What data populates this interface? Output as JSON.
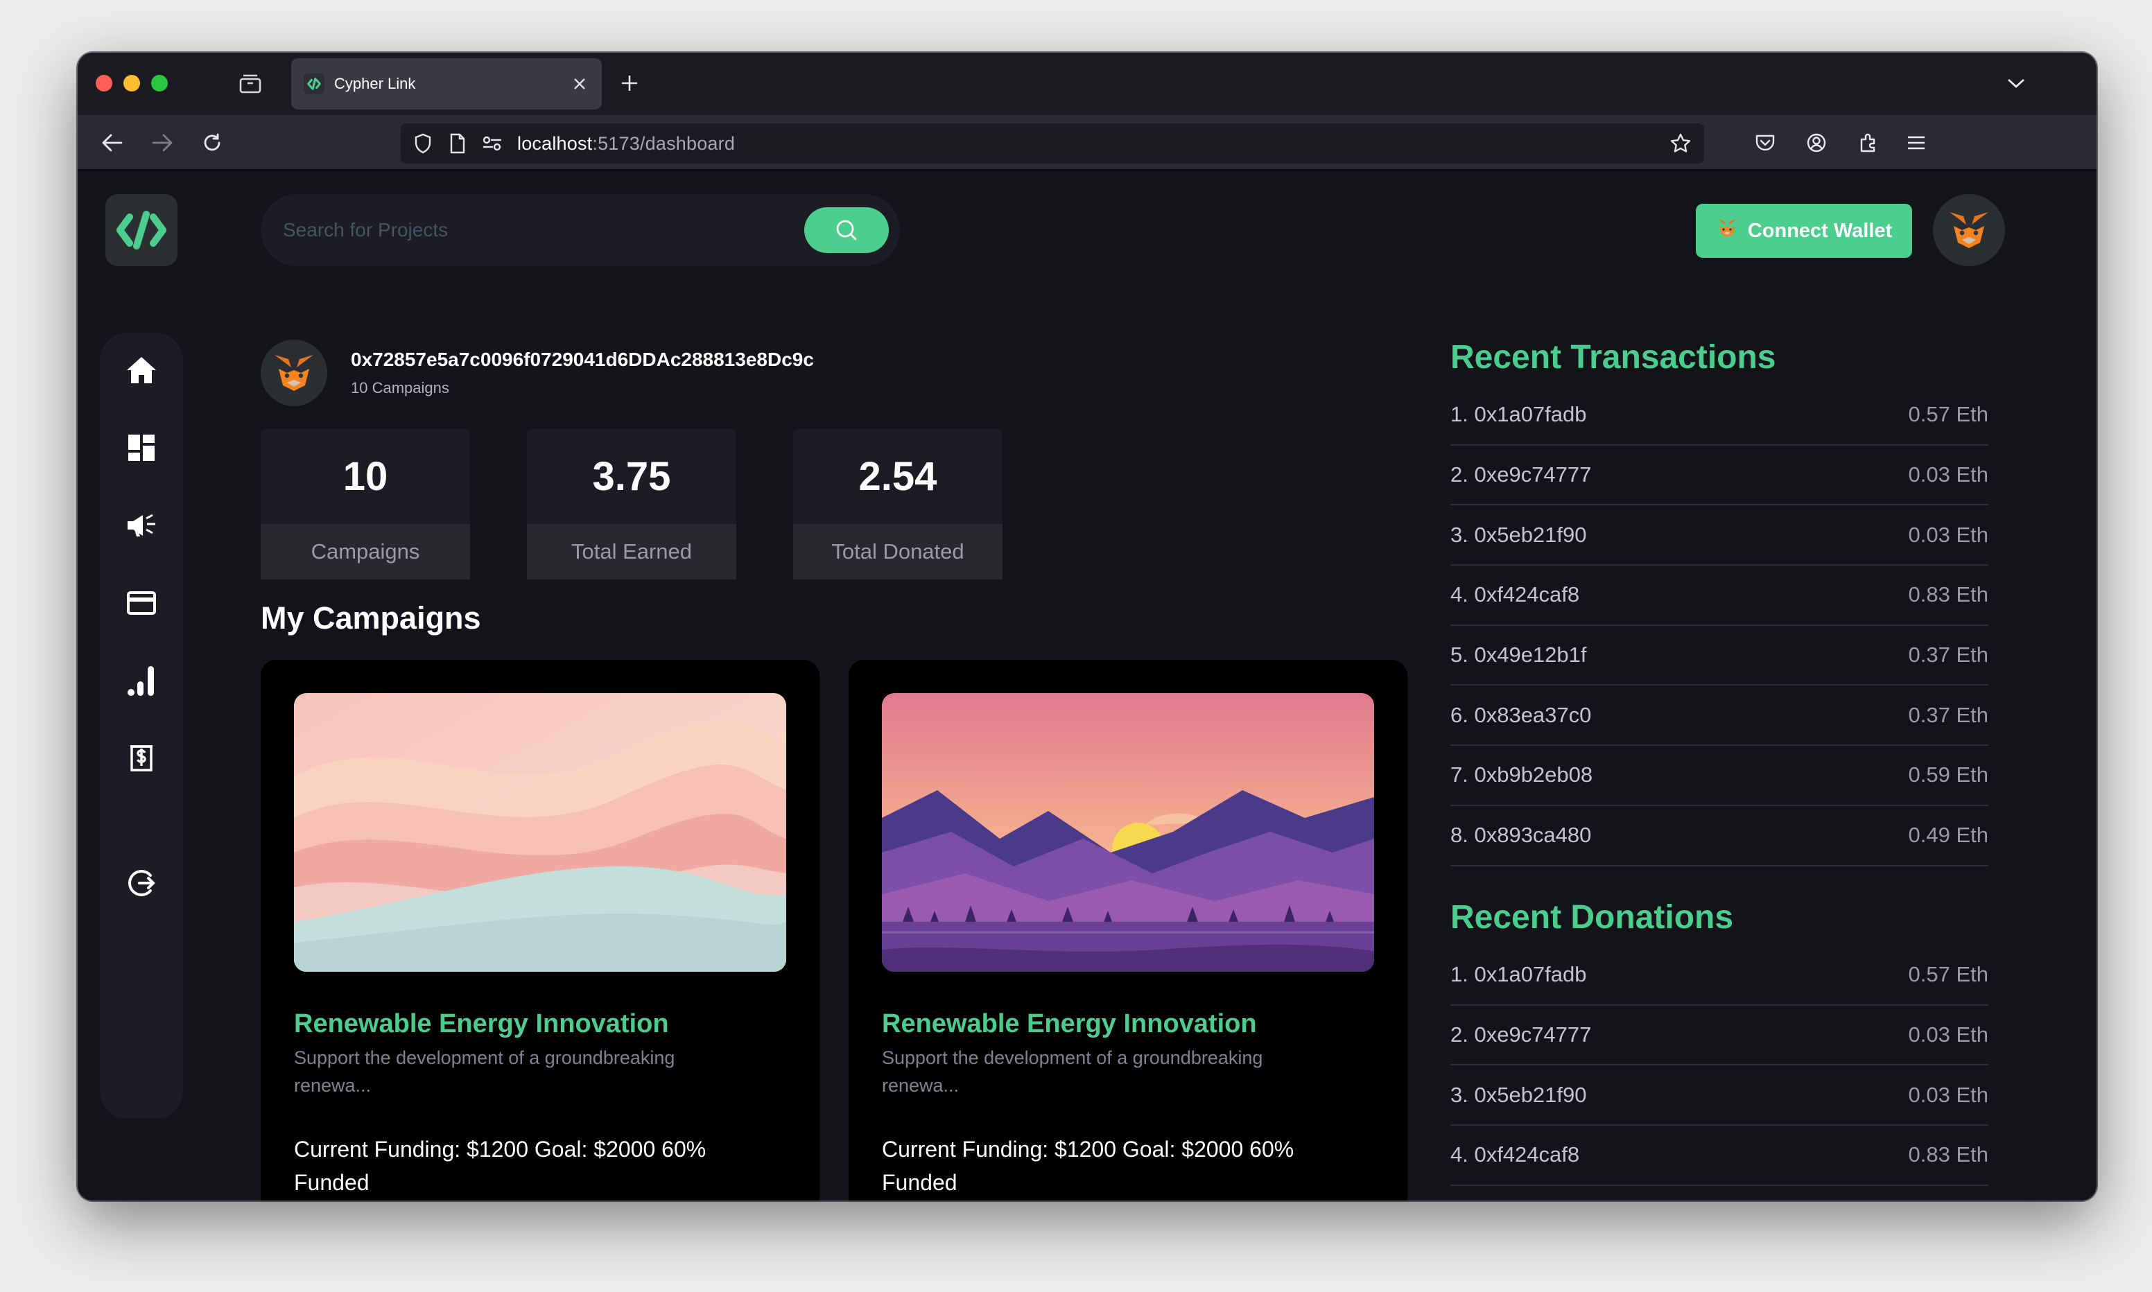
{
  "browser": {
    "tab_title": "Cypher Link",
    "url_host": "localhost",
    "url_path": ":5173/dashboard"
  },
  "header": {
    "search_placeholder": "Search for Projects",
    "connect_wallet_label": "Connect Wallet",
    "accent_color": "#4acd8d"
  },
  "sidebar": {
    "items": [
      {
        "icon": "home-icon"
      },
      {
        "icon": "dashboard-icon"
      },
      {
        "icon": "campaign-icon"
      },
      {
        "icon": "payment-card-icon"
      },
      {
        "icon": "chart-icon"
      },
      {
        "icon": "withdraw-icon"
      },
      {
        "icon": "logout-icon"
      }
    ]
  },
  "profile": {
    "address": "0x72857e5a7c0096f0729041d6DDAc288813e8Dc9c",
    "campaigns_text": "10 Campaigns"
  },
  "stats": [
    {
      "value": "10",
      "label": "Campaigns"
    },
    {
      "value": "3.75",
      "label": "Total Earned"
    },
    {
      "value": "2.54",
      "label": "Total Donated"
    }
  ],
  "my_campaigns": {
    "title": "My Campaigns",
    "cards": [
      {
        "title": "Renewable Energy Innovation",
        "description": "Support the development of a groundbreaking renewa...",
        "funding": "Current Funding: $1200 Goal: $2000 60% Funded",
        "image": "pastel-waves"
      },
      {
        "title": "Renewable Energy Innovation",
        "description": "Support the development of a groundbreaking renewa...",
        "funding": "Current Funding: $1200 Goal: $2000 60% Funded",
        "image": "mountain-sunset"
      }
    ]
  },
  "recent_transactions": {
    "title": "Recent Transactions",
    "items": [
      {
        "address": "1. 0x1a07fadb",
        "amount": "0.57 Eth"
      },
      {
        "address": "2. 0xe9c74777",
        "amount": "0.03 Eth"
      },
      {
        "address": "3. 0x5eb21f90",
        "amount": "0.03 Eth"
      },
      {
        "address": "4. 0xf424caf8",
        "amount": "0.83 Eth"
      },
      {
        "address": "5. 0x49e12b1f",
        "amount": "0.37 Eth"
      },
      {
        "address": "6. 0x83ea37c0",
        "amount": "0.37 Eth"
      },
      {
        "address": "7. 0xb9b2eb08",
        "amount": "0.59 Eth"
      },
      {
        "address": "8. 0x893ca480",
        "amount": "0.49 Eth"
      }
    ]
  },
  "recent_donations": {
    "title": "Recent Donations",
    "items": [
      {
        "address": "1. 0x1a07fadb",
        "amount": "0.57 Eth"
      },
      {
        "address": "2. 0xe9c74777",
        "amount": "0.03 Eth"
      },
      {
        "address": "3. 0x5eb21f90",
        "amount": "0.03 Eth"
      },
      {
        "address": "4. 0xf424caf8",
        "amount": "0.83 Eth"
      }
    ]
  }
}
